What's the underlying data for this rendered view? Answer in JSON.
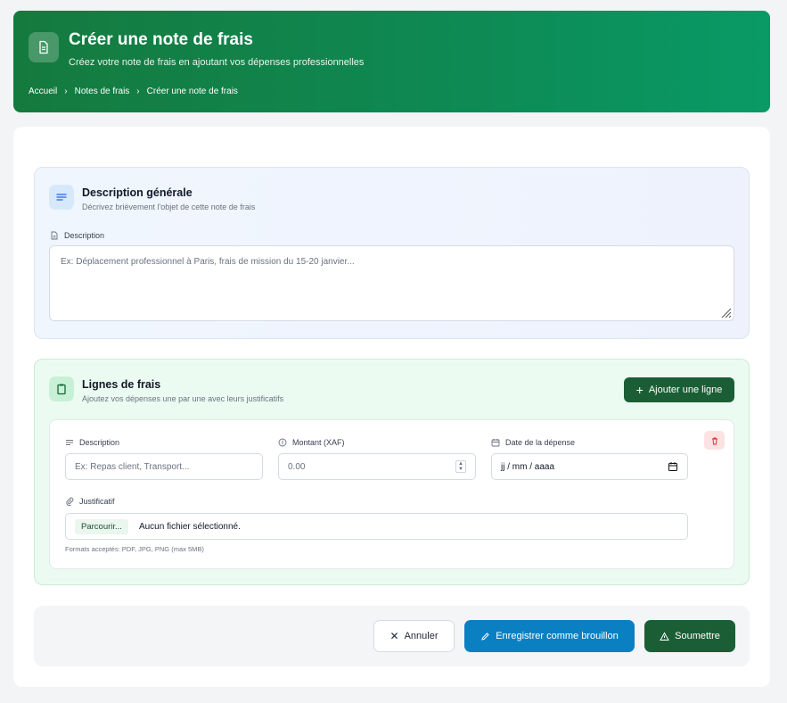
{
  "header": {
    "title": "Créer une note de frais",
    "subtitle": "Créez votre note de frais en ajoutant vos dépenses professionnelles",
    "breadcrumb": [
      "Accueil",
      "Notes de frais",
      "Créer une note de frais"
    ]
  },
  "general": {
    "title": "Description générale",
    "subtitle": "Décrivez brièvement l'objet de cette note de frais",
    "field_label": "Description",
    "placeholder": "Ex: Déplacement professionnel à Paris, frais de mission du 15-20 janvier..."
  },
  "lines": {
    "title": "Lignes de frais",
    "subtitle": "Ajoutez vos dépenses une par une avec leurs justificatifs",
    "add_button": "Ajouter une ligne",
    "row": {
      "description_label": "Description",
      "description_placeholder": "Ex: Repas client, Transport...",
      "amount_label": "Montant (XAF)",
      "amount_placeholder": "0.00",
      "date_label": "Date de la dépense",
      "date_placeholder": "jj / mm / aaaa",
      "proof_label": "Justificatif",
      "browse_label": "Parcourir...",
      "no_file": "Aucun fichier sélectionné.",
      "formats_hint": "Formats acceptés: PDF, JPG, PNG (max 5MB)"
    }
  },
  "footer": {
    "cancel": "Annuler",
    "save_draft": "Enregistrer comme brouillon",
    "submit": "Soumettre"
  },
  "colors": {
    "brand_green": "#157a3e",
    "accent_blue": "#0a80c2",
    "dark_green": "#1b5e35",
    "delete_red": "#dc2626"
  }
}
